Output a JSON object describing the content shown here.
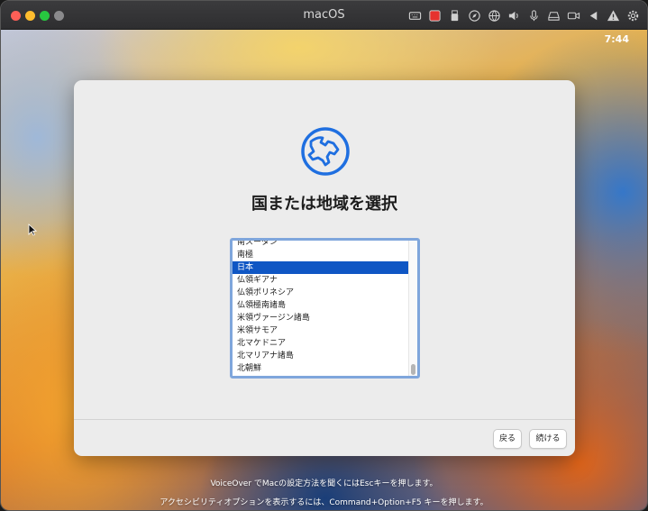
{
  "window": {
    "title": "macOS"
  },
  "toolbar_icons": [
    "keyboard-icon",
    "record-icon",
    "usb-icon",
    "compass-icon",
    "globe-icon",
    "speaker-icon",
    "microphone-icon",
    "drive-icon",
    "camera-icon",
    "play-back-icon",
    "warning-icon",
    "gear-icon"
  ],
  "menubar": {
    "clock": "7:44"
  },
  "setup": {
    "heading": "国または地域を選択",
    "regions": [
      "南スーダン",
      "南極",
      "日本",
      "仏領ギアナ",
      "仏領ポリネシア",
      "仏領極南諸島",
      "米領ヴァージン諸島",
      "米領サモア",
      "北マケドニア",
      "北マリアナ諸島",
      "北朝鮮"
    ],
    "selected": "日本",
    "back_label": "戻る",
    "continue_label": "続ける"
  },
  "footer": {
    "voiceover_hint": "VoiceOver でMacの設定方法を聞くにはEscキーを押します。",
    "accessibility_hint": "アクセシビリティオプションを表示するには、Command+Option+F5 キーを押します。"
  },
  "colors": {
    "accent": "#0f56c4",
    "panel": "#ececec",
    "list_border": "#7fa6dc"
  }
}
